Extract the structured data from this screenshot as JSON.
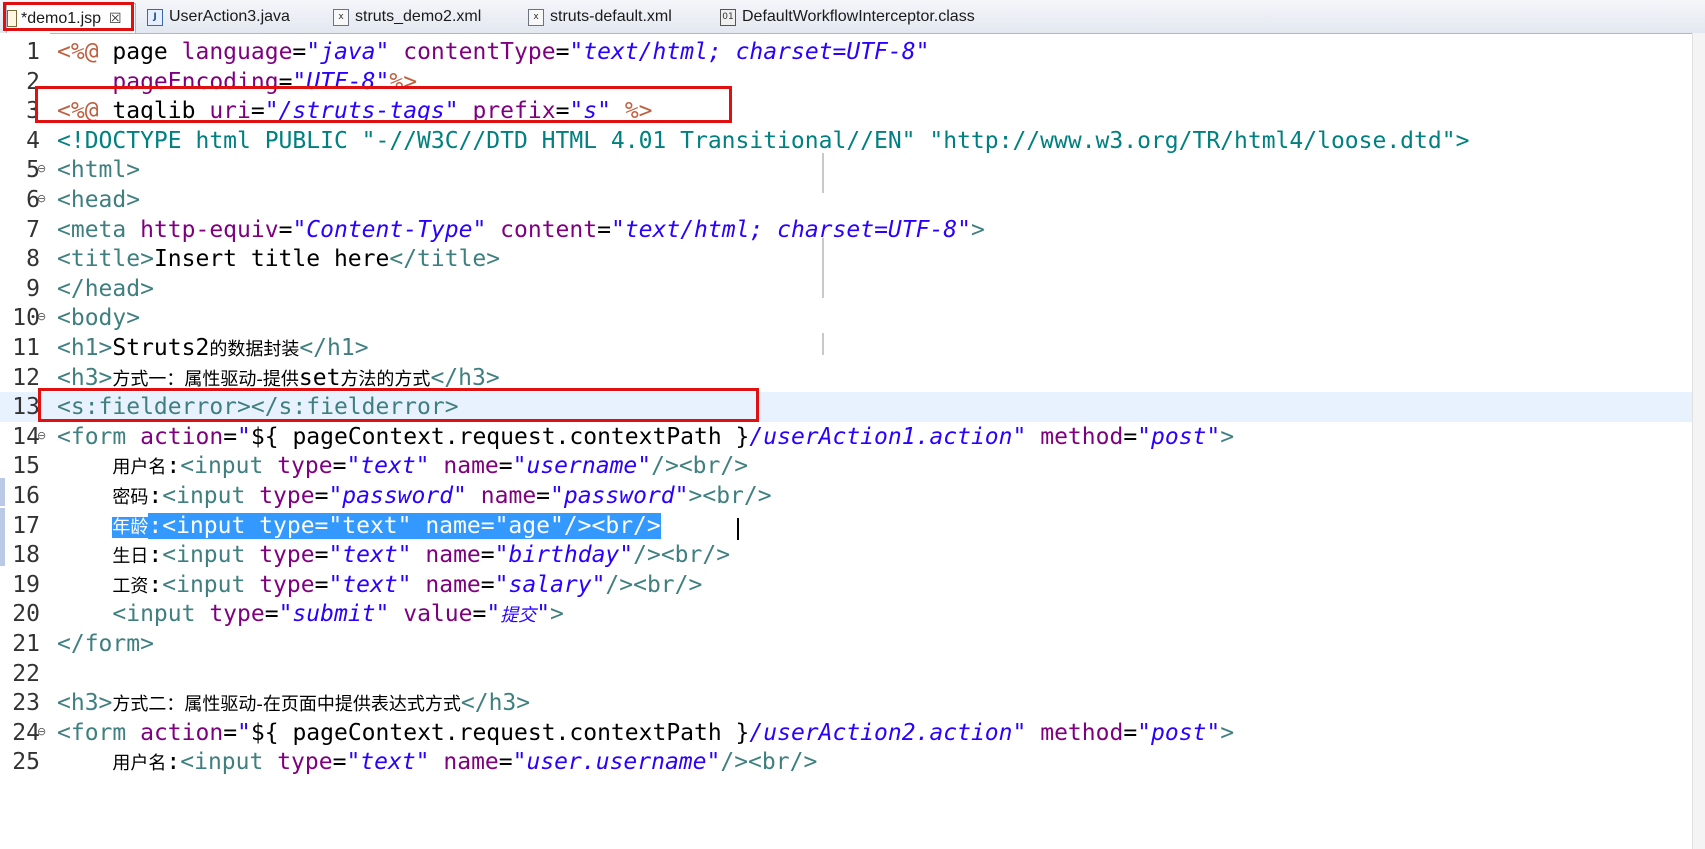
{
  "tabs": [
    {
      "label": "*demo1.jsp",
      "icon": "jsp-file-icon",
      "active": true
    },
    {
      "label": "UserAction3.java",
      "icon": "java-file-icon",
      "active": false
    },
    {
      "label": "struts_demo2.xml",
      "icon": "xml-file-icon",
      "active": false
    },
    {
      "label": "struts-default.xml",
      "icon": "xml-file-icon",
      "active": false
    },
    {
      "label": "DefaultWorkflowInterceptor.class",
      "icon": "class-file-icon",
      "active": false
    }
  ],
  "close_glyph": "☒",
  "colors": {
    "highlight_box": "#e01010",
    "selection": "#3399ff",
    "attr_value": "#2a00ff",
    "tag": "#3f7f7f"
  },
  "lines": [
    {
      "n": "1",
      "fold": "",
      "tokens": [
        [
          "dir",
          "<%@ "
        ],
        [
          "txt",
          "page "
        ],
        [
          "attr",
          "language"
        ],
        [
          "txt",
          "="
        ],
        [
          "val",
          "\"java\""
        ],
        [
          "txt",
          " "
        ],
        [
          "attr",
          "contentType"
        ],
        [
          "txt",
          "="
        ],
        [
          "val",
          "\"text/html; charset=UTF-8\""
        ]
      ]
    },
    {
      "n": "2",
      "fold": "",
      "tokens": [
        [
          "txt",
          "    "
        ],
        [
          "attr",
          "pageEncoding"
        ],
        [
          "txt",
          "="
        ],
        [
          "val",
          "\"UTF-8\""
        ],
        [
          "dir",
          "%>"
        ]
      ]
    },
    {
      "n": "3",
      "fold": "",
      "tokens": [
        [
          "dir",
          "<%@ "
        ],
        [
          "txt",
          "taglib "
        ],
        [
          "attr",
          "uri"
        ],
        [
          "txt",
          "="
        ],
        [
          "val",
          "\"/struts-tags\""
        ],
        [
          "txt",
          " "
        ],
        [
          "attr",
          "prefix"
        ],
        [
          "txt",
          "="
        ],
        [
          "val",
          "\"s\""
        ],
        [
          "txt",
          " "
        ],
        [
          "dir",
          "%>"
        ]
      ]
    },
    {
      "n": "4",
      "fold": "",
      "tokens": [
        [
          "doct",
          "<!DOCTYPE html PUBLIC \"-//W3C//DTD HTML 4.01 Transitional//EN\" \"http://www.w3.org/TR/html4/loose.dtd\">"
        ]
      ]
    },
    {
      "n": "5",
      "fold": "⊖",
      "tokens": [
        [
          "ctag",
          "<html>"
        ]
      ]
    },
    {
      "n": "6",
      "fold": "⊖",
      "tokens": [
        [
          "ctag",
          "<head>"
        ]
      ]
    },
    {
      "n": "7",
      "fold": "",
      "tokens": [
        [
          "ctag",
          "<meta "
        ],
        [
          "attr",
          "http-equiv"
        ],
        [
          "txt",
          "="
        ],
        [
          "val",
          "\"Content-Type\""
        ],
        [
          "txt",
          " "
        ],
        [
          "attr",
          "content"
        ],
        [
          "txt",
          "="
        ],
        [
          "val",
          "\"text/html; charset=UTF-8\""
        ],
        [
          "ctag",
          ">"
        ]
      ]
    },
    {
      "n": "8",
      "fold": "",
      "tokens": [
        [
          "ctag",
          "<title>"
        ],
        [
          "txt",
          "Insert title here"
        ],
        [
          "ctag",
          "</title>"
        ]
      ]
    },
    {
      "n": "9",
      "fold": "",
      "tokens": [
        [
          "ctag",
          "</head>"
        ]
      ]
    },
    {
      "n": "10",
      "fold": "⊖",
      "tokens": [
        [
          "ctag",
          "<body>"
        ]
      ]
    },
    {
      "n": "11",
      "fold": "",
      "tokens": [
        [
          "ctag",
          "<h1>"
        ],
        [
          "txt",
          "Struts2"
        ],
        [
          "cjk",
          "的数据封装"
        ],
        [
          "ctag",
          "</h1>"
        ]
      ]
    },
    {
      "n": "12",
      "fold": "",
      "tokens": [
        [
          "ctag",
          "<h3>"
        ],
        [
          "cjk",
          "方式一：属性驱动-提供"
        ],
        [
          "txt",
          "set"
        ],
        [
          "cjk",
          "方法的方式"
        ],
        [
          "ctag",
          "</h3>"
        ]
      ]
    },
    {
      "n": "13",
      "fold": "",
      "tokens": [
        [
          "ctag",
          "<s:fielderror></s:fielderror>"
        ]
      ]
    },
    {
      "n": "14",
      "fold": "⊖",
      "tokens": [
        [
          "ctag",
          "<form "
        ],
        [
          "attr",
          "action"
        ],
        [
          "txt",
          "="
        ],
        [
          "val",
          "\""
        ],
        [
          "txt",
          "${ pageContext.request.contextPath }"
        ],
        [
          "val",
          "/userAction1.action\""
        ],
        [
          "txt",
          " "
        ],
        [
          "attr",
          "method"
        ],
        [
          "txt",
          "="
        ],
        [
          "val",
          "\"post\""
        ],
        [
          "ctag",
          ">"
        ]
      ]
    },
    {
      "n": "15",
      "fold": "",
      "tokens": [
        [
          "txt",
          "    "
        ],
        [
          "cjk",
          "用户名"
        ],
        [
          "txt",
          ":"
        ],
        [
          "ctag",
          "<input "
        ],
        [
          "attr",
          "type"
        ],
        [
          "txt",
          "="
        ],
        [
          "val",
          "\"text\""
        ],
        [
          "txt",
          " "
        ],
        [
          "attr",
          "name"
        ],
        [
          "txt",
          "="
        ],
        [
          "val",
          "\"username\""
        ],
        [
          "ctag",
          "/><br/>"
        ]
      ]
    },
    {
      "n": "16",
      "fold": "",
      "tokens": [
        [
          "txt",
          "    "
        ],
        [
          "cjk",
          "密码"
        ],
        [
          "txt",
          ":"
        ],
        [
          "ctag",
          "<input "
        ],
        [
          "attr",
          "type"
        ],
        [
          "txt",
          "="
        ],
        [
          "val",
          "\"password\""
        ],
        [
          "txt",
          " "
        ],
        [
          "attr",
          "name"
        ],
        [
          "txt",
          "="
        ],
        [
          "val",
          "\"password\""
        ],
        [
          "ctag",
          "><br/>"
        ]
      ]
    },
    {
      "n": "17",
      "fold": "",
      "tokens": [
        [
          "txt",
          "    "
        ],
        [
          "sel-cjk",
          "年龄"
        ],
        [
          "sel",
          ":<input type=\"text\" name=\"age\"/><br/>"
        ]
      ]
    },
    {
      "n": "18",
      "fold": "",
      "tokens": [
        [
          "txt",
          "    "
        ],
        [
          "cjk",
          "生日"
        ],
        [
          "txt",
          ":"
        ],
        [
          "ctag",
          "<input "
        ],
        [
          "attr",
          "type"
        ],
        [
          "txt",
          "="
        ],
        [
          "val",
          "\"text\""
        ],
        [
          "txt",
          " "
        ],
        [
          "attr",
          "name"
        ],
        [
          "txt",
          "="
        ],
        [
          "val",
          "\"birthday\""
        ],
        [
          "ctag",
          "/><br/>"
        ]
      ]
    },
    {
      "n": "19",
      "fold": "",
      "tokens": [
        [
          "txt",
          "    "
        ],
        [
          "cjk",
          "工资"
        ],
        [
          "txt",
          ":"
        ],
        [
          "ctag",
          "<input "
        ],
        [
          "attr",
          "type"
        ],
        [
          "txt",
          "="
        ],
        [
          "val",
          "\"text\""
        ],
        [
          "txt",
          " "
        ],
        [
          "attr",
          "name"
        ],
        [
          "txt",
          "="
        ],
        [
          "val",
          "\"salary\""
        ],
        [
          "ctag",
          "/><br/>"
        ]
      ]
    },
    {
      "n": "20",
      "fold": "",
      "tokens": [
        [
          "txt",
          "    "
        ],
        [
          "ctag",
          "<input "
        ],
        [
          "attr",
          "type"
        ],
        [
          "txt",
          "="
        ],
        [
          "val",
          "\"submit\""
        ],
        [
          "txt",
          " "
        ],
        [
          "attr",
          "value"
        ],
        [
          "txt",
          "="
        ],
        [
          "val",
          "\""
        ],
        [
          "valcjk",
          "提交"
        ],
        [
          "val",
          "\""
        ],
        [
          "ctag",
          ">"
        ]
      ]
    },
    {
      "n": "21",
      "fold": "",
      "tokens": [
        [
          "ctag",
          "</form>"
        ]
      ]
    },
    {
      "n": "22",
      "fold": "",
      "tokens": []
    },
    {
      "n": "23",
      "fold": "",
      "tokens": [
        [
          "ctag",
          "<h3>"
        ],
        [
          "cjk",
          "方式二：属性驱动-在页面中提供表达式方式"
        ],
        [
          "ctag",
          "</h3>"
        ]
      ]
    },
    {
      "n": "24",
      "fold": "⊖",
      "tokens": [
        [
          "ctag",
          "<form "
        ],
        [
          "attr",
          "action"
        ],
        [
          "txt",
          "="
        ],
        [
          "val",
          "\""
        ],
        [
          "txt",
          "${ pageContext.request.contextPath }"
        ],
        [
          "val",
          "/userAction2.action\""
        ],
        [
          "txt",
          " "
        ],
        [
          "attr",
          "method"
        ],
        [
          "txt",
          "="
        ],
        [
          "val",
          "\"post\""
        ],
        [
          "ctag",
          ">"
        ]
      ]
    },
    {
      "n": "25",
      "fold": "",
      "tokens": [
        [
          "txt",
          "    "
        ],
        [
          "cjk",
          "用户名"
        ],
        [
          "txt",
          ":"
        ],
        [
          "ctag",
          "<input "
        ],
        [
          "attr",
          "type"
        ],
        [
          "txt",
          "="
        ],
        [
          "val",
          "\"text\""
        ],
        [
          "txt",
          " "
        ],
        [
          "attr",
          "name"
        ],
        [
          "txt",
          "="
        ],
        [
          "val",
          "\"user.username\""
        ],
        [
          "ctag",
          "/><br/>"
        ]
      ]
    }
  ]
}
